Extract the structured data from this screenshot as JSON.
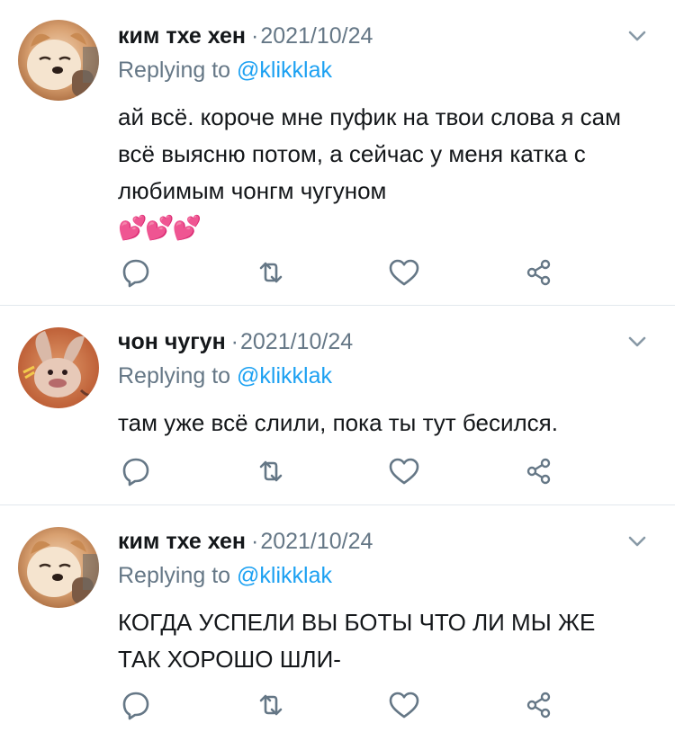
{
  "colors": {
    "name": "#14171a",
    "meta": "#657786",
    "link": "#1da1f2",
    "divider": "#e1e8ed"
  },
  "tweets": [
    {
      "author": "ким тхе хен",
      "separator": "·",
      "date": "2021/10/24",
      "replying_prefix": "Replying to",
      "replying_handle": "@klikklak",
      "text": "ай всё. короче мне пуфик на твои слова я сам всё выясню потом, а сейчас у меня катка с любимым чонгм чугуном",
      "emoji": "💕💕💕"
    },
    {
      "author": "чон чугун",
      "separator": "·",
      "date": "2021/10/24",
      "replying_prefix": "Replying to",
      "replying_handle": "@klikklak",
      "text": "там уже всё слили, пока ты тут бесился."
    },
    {
      "author": "ким тхе хен",
      "separator": "·",
      "date": "2021/10/24",
      "replying_prefix": "Replying to",
      "replying_handle": "@klikklak",
      "text": "КОГДА УСПЕЛИ ВЫ БОТЫ ЧТО ЛИ МЫ ЖЕ ТАК ХОРОШО ШЛИ-"
    }
  ],
  "icons": {
    "menu": "chevron-down-icon",
    "reply": "reply-icon",
    "retweet": "retweet-icon",
    "like": "heart-icon",
    "share": "share-icon"
  }
}
